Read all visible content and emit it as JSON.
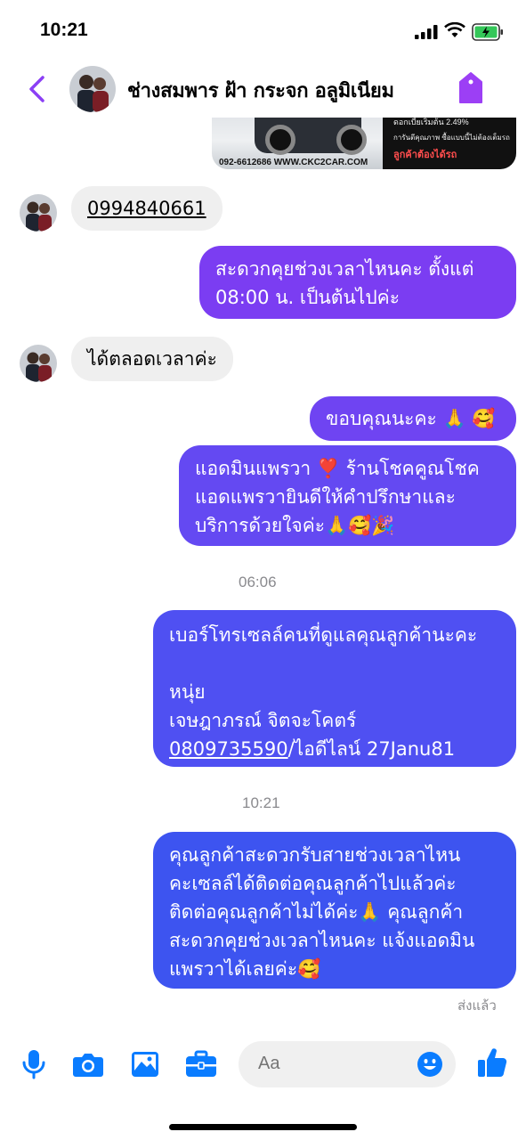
{
  "status_bar": {
    "time": "10:21"
  },
  "header": {
    "title": "ช่างสมพาร ฝ้า กระจก อลูมิเนียม"
  },
  "ad": {
    "line1": "ดอกเบี้ยเริ่มต้น 2.49%",
    "line2": "การันตีคุณภาพ ซื้อแบบนี้ไม่ต้องเต็มรถ",
    "line3": "ลูกค้าต้องได้รถ",
    "footer": "092-6612686  WWW.CKC2CAR.COM"
  },
  "messages": [
    {
      "type": "in",
      "lines": [
        "0994840661"
      ]
    },
    {
      "type": "out",
      "lines": [
        "สะดวกคุยช่วงเวลาไหนคะ ตั้งแต่",
        "08:00 น. เป็นต้นไปค่ะ"
      ]
    },
    {
      "type": "in",
      "lines": [
        "ได้ตลอดเวลาค่ะ"
      ]
    },
    {
      "type": "out",
      "lines": [
        "ขอบคุณนะคะ 🙏 🥰"
      ]
    },
    {
      "type": "out",
      "lines": [
        "แอดมินแพรวา ❣️ ร้านโชคคูณโชค",
        "แอดแพรวายินดีให้คำปรึกษาและ",
        "บริการด้วยใจค่ะ🙏🥰🎉"
      ]
    },
    {
      "type": "out",
      "lines": [
        "เบอร์โทรเซลล์คนที่ดูแลคุณลูกค้านะคะ",
        "",
        "หนุ่ย",
        "เจษฎาภรณ์ จิตจะโคตร์",
        "0809735590",
        "/ไอดีไลน์ 27Janu81"
      ]
    },
    {
      "type": "out",
      "lines": [
        "คุณลูกค้าสะดวกรับสายช่วงเวลาไหน",
        "คะเซลล์ได้ติดต่อคุณลูกค้าไปแล้วค่ะ",
        "ติดต่อคุณลูกค้าไม่ได้ค่ะ🙏  คุณลูกค้า",
        "สะดวกคุยช่วงเวลาไหนคะ แจ้งแอดมิน",
        "แพรวาได้เลยค่ะ🥰"
      ]
    }
  ],
  "timestamps": [
    "06:06",
    "10:21"
  ],
  "seen_label": "ส่งแล้ว",
  "composer": {
    "placeholder": "Aa"
  },
  "colors": {
    "accent": "#8b3ff5",
    "bubble_purple": "#7b3df2",
    "bubble_blue": "#3d54f0"
  }
}
